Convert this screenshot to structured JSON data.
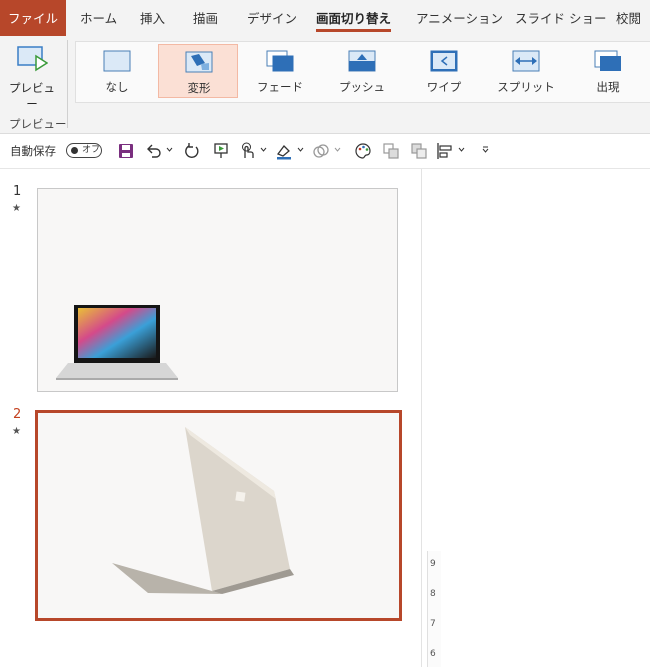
{
  "tabs": [
    "ファイル",
    "ホーム",
    "挿入",
    "描画",
    "デザイン",
    "画面切り替え",
    "アニメーション",
    "スライド ショー",
    "校閲"
  ],
  "ribbon": {
    "preview_label": "プレビュー",
    "group_label": "プレビュー",
    "transitions": [
      "なし",
      "変形",
      "フェード",
      "プッシュ",
      "ワイプ",
      "スプリット",
      "出現"
    ],
    "selected_transition": "変形"
  },
  "qat": {
    "autosave_label": "自動保存",
    "autosave_state": "オフ"
  },
  "slides": [
    {
      "number": "1",
      "selected": false
    },
    {
      "number": "2",
      "selected": true
    }
  ],
  "ruler_marks": [
    "9",
    "8",
    "7",
    "6"
  ],
  "colors": {
    "accent": "#b7472a",
    "ribbon_bg": "#f3f3f3",
    "selected_gallery": "#fbe0d5"
  }
}
